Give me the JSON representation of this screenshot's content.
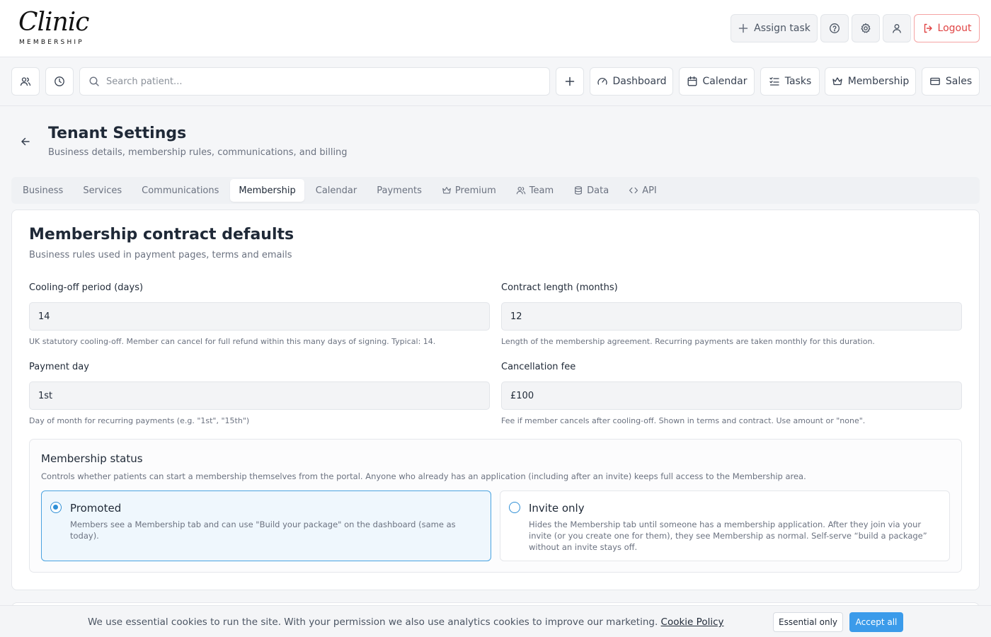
{
  "logo": {
    "script": "Clinic",
    "sub": "MEMBERSHIP"
  },
  "header": {
    "assign_task": "Assign task",
    "logout": "Logout"
  },
  "nav": {
    "search_placeholder": "Search patient...",
    "dashboard": "Dashboard",
    "calendar": "Calendar",
    "tasks": "Tasks",
    "membership": "Membership",
    "sales": "Sales"
  },
  "page": {
    "title": "Tenant Settings",
    "subtitle": "Business details, membership rules, communications, and billing"
  },
  "tabs": [
    {
      "label": "Business"
    },
    {
      "label": "Services"
    },
    {
      "label": "Communications"
    },
    {
      "label": "Membership"
    },
    {
      "label": "Calendar"
    },
    {
      "label": "Payments"
    },
    {
      "label": "Premium"
    },
    {
      "label": "Team"
    },
    {
      "label": "Data"
    },
    {
      "label": "API"
    }
  ],
  "card": {
    "title": "Membership contract defaults",
    "subtitle": "Business rules used in payment pages, terms and emails"
  },
  "fields": {
    "cooling_off": {
      "label": "Cooling-off period (days)",
      "value": "14",
      "help": "UK statutory cooling-off. Member can cancel for full refund within this many days of signing. Typical: 14."
    },
    "contract_length": {
      "label": "Contract length (months)",
      "value": "12",
      "help": "Length of the membership agreement. Recurring payments are taken monthly for this duration."
    },
    "payment_day": {
      "label": "Payment day",
      "value": "1st",
      "help": "Day of month for recurring payments (e.g. \"1st\", \"15th\")"
    },
    "cancellation_fee": {
      "label": "Cancellation fee",
      "value": "£100",
      "help": "Fee if member cancels after cooling-off. Shown in terms and contract. Use amount or \"none\"."
    }
  },
  "status": {
    "title": "Membership status",
    "desc": "Controls whether patients can start a membership themselves from the portal. Anyone who already has an application (including after an invite) keeps full access to the Membership area.",
    "promoted": {
      "title": "Promoted",
      "desc": "Members see a Membership tab and can use \"Build your package\" on the dashboard (same as today)."
    },
    "invite_only": {
      "title": "Invite only",
      "desc": "Hides the Membership tab until someone has a membership application. After they join via your invite (or you create one for them), they see Membership as normal. Self-serve “build a package” without an invite stays off."
    }
  },
  "cookie": {
    "text": "We use essential cookies to run the site. With your permission we also use analytics cookies to improve our marketing.",
    "link": "Cookie Policy",
    "essential": "Essential only",
    "accept": "Accept all"
  },
  "colors": {
    "accent": "#3b9bea",
    "danger": "#e04444"
  }
}
